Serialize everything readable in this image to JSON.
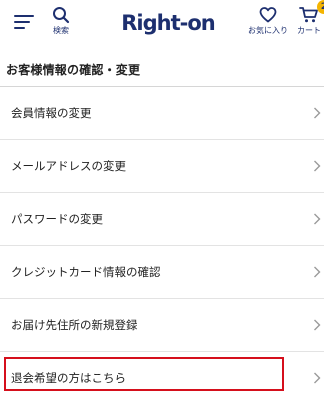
{
  "header": {
    "search_label": "検索",
    "favorites_label": "お気に入り",
    "cart_label": "カート",
    "cart_count": "2",
    "logo_text": "Right-on",
    "brand_color": "#1d2f6f",
    "badge_color": "#f4b400"
  },
  "page": {
    "title": "お客様情報の確認・変更"
  },
  "menu": {
    "items": [
      {
        "label": "会員情報の変更"
      },
      {
        "label": "メールアドレスの変更"
      },
      {
        "label": "パスワードの変更"
      },
      {
        "label": "クレジットカード情報の確認"
      },
      {
        "label": "お届け先住所の新規登録"
      },
      {
        "label": "退会希望の方はこちら"
      }
    ],
    "highlight_color": "#d50f1c"
  }
}
